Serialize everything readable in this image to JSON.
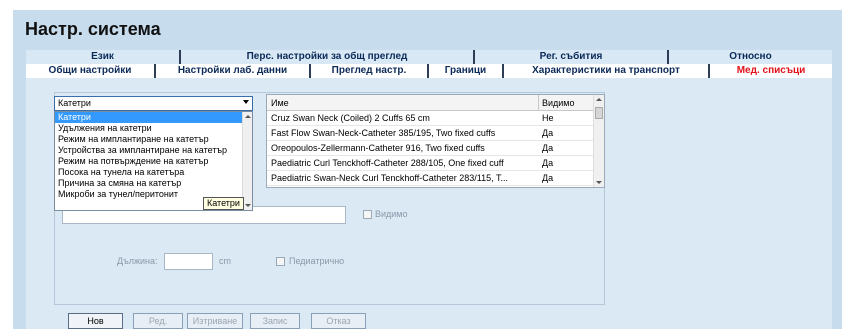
{
  "window": {
    "title": "Настр. система"
  },
  "tabs_row1": [
    {
      "label": "Език"
    },
    {
      "label": "Перс. настройки за общ преглед"
    },
    {
      "label": "Рег. събития"
    },
    {
      "label": "Относно"
    }
  ],
  "tabs_row2": [
    {
      "label": "Общи настройки"
    },
    {
      "label": "Настройки лаб. данни"
    },
    {
      "label": "Преглед настр."
    },
    {
      "label": "Граници"
    },
    {
      "label": "Характеристики на транспорт"
    },
    {
      "label": "Мед. списъци",
      "active": true
    }
  ],
  "category_combo": {
    "value": "Катетри"
  },
  "category_dropdown": {
    "items": [
      "Катетри",
      "Удължения на катетри",
      "Режим на имплантиране на катетър",
      "Устройства за имплантиране на катетър",
      "Режим на потвърждение на катетър",
      "Посока на тунела на катетъра",
      "Причина за смяна на катетър",
      "Микроби за тунел/перитонит"
    ],
    "selected_index": 0
  },
  "tooltip": {
    "text": "Катетри"
  },
  "table": {
    "columns": [
      "Име",
      "Видимо"
    ],
    "rows": [
      [
        "Cruz Swan Neck (Coiled) 2 Cuffs 65 cm",
        "Не"
      ],
      [
        "Fast Flow Swan-Neck-Catheter 385/195, Two fixed cuffs",
        "Да"
      ],
      [
        "Oreopoulos-Zellermann-Catheter 916, Two fixed cuffs",
        "Да"
      ],
      [
        "Paediatric Curl Tenckhoff-Catheter 288/105, One fixed cuff",
        "Да"
      ],
      [
        "Paediatric Swan-Neck Curl Tenckhoff-Catheter 283/115, T...",
        "Да"
      ]
    ]
  },
  "form": {
    "visible_label": "Видимо",
    "length_label": "Дължина:",
    "length_unit": "cm",
    "pediatric_label": "Педиатрично"
  },
  "buttons": {
    "new": "Нов",
    "edit": "Ред.",
    "delete": "Изтриване",
    "save": "Запис",
    "cancel": "Отказ"
  }
}
